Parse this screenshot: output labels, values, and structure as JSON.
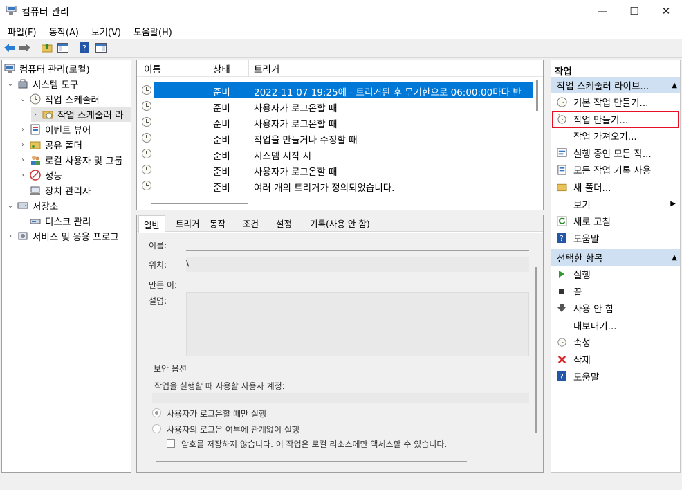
{
  "window": {
    "title": "컴퓨터 관리",
    "minimize": "—",
    "maximize": "☐",
    "close": "✕"
  },
  "menu": [
    "파일(F)",
    "동작(A)",
    "보기(V)",
    "도움말(H)"
  ],
  "tree": {
    "root": "컴퓨터 관리(로컬)",
    "system_tools": "시스템 도구",
    "task_scheduler": "작업 스케줄러",
    "task_scheduler_library": "작업 스케줄러 라",
    "event_viewer": "이벤트 뷰어",
    "shared_folders": "공유 폴더",
    "local_users": "로컬 사용자 및 그룹",
    "performance": "성능",
    "device_manager": "장치 관리자",
    "storage": "저장소",
    "disk_management": "디스크 관리",
    "services": "서비스 및 응용 프로그"
  },
  "task_table": {
    "headers": [
      "이름",
      "상태",
      "트리거"
    ],
    "rows": [
      {
        "name": "",
        "status": "준비",
        "trigger": "2022-11-07 19:25에 - 트리거된 후 무기한으로 06:00:00마다 반"
      },
      {
        "name": "",
        "status": "준비",
        "trigger": "사용자가 로그온할 때"
      },
      {
        "name": "",
        "status": "준비",
        "trigger": "사용자가 로그온할 때"
      },
      {
        "name": "",
        "status": "준비",
        "trigger": "작업을 만들거나 수정할 때"
      },
      {
        "name": "",
        "status": "준비",
        "trigger": "시스템 시작 시"
      },
      {
        "name": "",
        "status": "준비",
        "trigger": "사용자가 로그온할 때"
      },
      {
        "name": "",
        "status": "준비",
        "trigger": "여러 개의 트리거가 정의되었습니다."
      }
    ]
  },
  "detail_tabs": [
    "일반",
    "트리거",
    "동작",
    "조건",
    "설정",
    "기록(사용 안 함)"
  ],
  "general": {
    "name_label": "이름:",
    "location_label": "위치:",
    "location_value": "\\",
    "author_label": "만든 이:",
    "desc_label": "설명:",
    "security_title": "보안 옵션",
    "account_prompt": "작업을 실행할 때 사용할 사용자 계정:",
    "radio_logged_on": "사용자가 로그온할 때만 실행",
    "radio_whether": "사용자의 로그온 여부에 관계없이 실행",
    "no_store_password": "암호를 저장하지 않습니다. 이 작업은 로컬 리소스에만 액세스할 수 있습니다."
  },
  "actions": {
    "title": "작업",
    "section1": "작업 스케줄러 라이브...",
    "items1": [
      {
        "label": "기본 작업 만들기...",
        "icon": "basic-task-icon"
      },
      {
        "label": "작업 만들기...",
        "icon": "create-task-icon"
      },
      {
        "label": "작업 가져오기...",
        "icon": ""
      },
      {
        "label": "실행 중인 모든 작...",
        "icon": "running-tasks-icon"
      },
      {
        "label": "모든 작업 기록 사용",
        "icon": "history-icon"
      },
      {
        "label": "새 폴더...",
        "icon": "folder-icon"
      },
      {
        "label": "보기",
        "icon": ""
      },
      {
        "label": "새로 고침",
        "icon": "refresh-icon"
      },
      {
        "label": "도움말",
        "icon": "help-icon"
      }
    ],
    "section2": "선택한 항목",
    "items2": [
      {
        "label": "실행",
        "icon": "run-icon"
      },
      {
        "label": "끝",
        "icon": "end-icon"
      },
      {
        "label": "사용 안 함",
        "icon": "disable-icon"
      },
      {
        "label": "내보내기...",
        "icon": ""
      },
      {
        "label": "속성",
        "icon": "properties-icon"
      },
      {
        "label": "삭제",
        "icon": "delete-icon"
      },
      {
        "label": "도움말",
        "icon": "help-icon"
      }
    ]
  },
  "colors": {
    "selection": "#0078d7",
    "section_header": "#cfe0f2",
    "highlight_box": "#e81123"
  }
}
